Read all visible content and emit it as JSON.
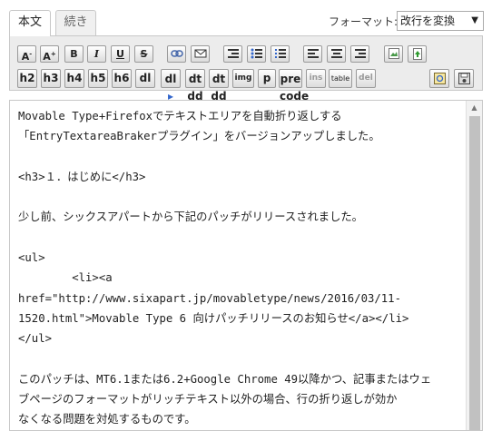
{
  "tabs": [
    {
      "label": "本文",
      "active": true
    },
    {
      "label": "続き",
      "active": false
    }
  ],
  "format": {
    "label": "フォーマット:",
    "selected": "改行を変換",
    "caret": "▼"
  },
  "toolbar": {
    "row1": [
      {
        "name": "font-smaller-button",
        "label": "A",
        "icon": "font-decrease-icon"
      },
      {
        "name": "font-larger-button",
        "label": "A",
        "icon": "font-increase-icon"
      },
      {
        "name": "bold-button",
        "label": "B"
      },
      {
        "name": "italic-button",
        "label": "I"
      },
      {
        "name": "underline-button",
        "label": "U"
      },
      {
        "name": "strikethrough-button",
        "label": "S"
      },
      {
        "name": "link-button",
        "icon": "link-icon"
      },
      {
        "name": "email-button",
        "icon": "envelope-icon"
      },
      {
        "name": "indent-button",
        "icon": "indent-icon"
      },
      {
        "name": "bullet-list-button",
        "icon": "bullet-list-icon"
      },
      {
        "name": "numbered-list-button",
        "icon": "numbered-list-icon"
      },
      {
        "name": "align-left-button",
        "icon": "align-left-icon"
      },
      {
        "name": "align-center-button",
        "icon": "align-center-icon"
      },
      {
        "name": "align-right-button",
        "icon": "align-right-icon"
      },
      {
        "name": "insert-image-button",
        "icon": "image-icon"
      },
      {
        "name": "insert-file-button",
        "icon": "upload-file-icon"
      }
    ],
    "row2": [
      {
        "name": "h2-button",
        "label": "h2"
      },
      {
        "name": "h3-button",
        "label": "h3"
      },
      {
        "name": "h4-button",
        "label": "h4"
      },
      {
        "name": "h5-button",
        "label": "h5"
      },
      {
        "name": "h6-button",
        "label": "h6"
      },
      {
        "name": "dl-button",
        "label": "dl"
      },
      {
        "name": "dl-dt-button",
        "label": "dl"
      },
      {
        "name": "dt-dd-button",
        "label": "dt dd"
      },
      {
        "name": "dt-dd-2-button",
        "label": "dt dd"
      },
      {
        "name": "img-button",
        "label": "img"
      },
      {
        "name": "p-button",
        "label": "p"
      },
      {
        "name": "pre-code-button",
        "label": "pre code"
      },
      {
        "name": "ins-button",
        "label": "ins"
      },
      {
        "name": "table-button",
        "label": "table"
      },
      {
        "name": "del-button",
        "label": "del"
      },
      {
        "name": "preview-button",
        "icon": "preview-icon"
      },
      {
        "name": "save-button",
        "icon": "save-icon"
      }
    ]
  },
  "editor": {
    "lines": [
      "Movable Type+Firefoxでテキストエリアを自動折り返しする",
      "「EntryTextareaBrakerプラグイン」をバージョンアップしました。",
      "",
      "<h3>１．はじめに</h3>",
      "",
      "少し前、シックスアパートから下記のパッチがリリースされました。",
      "",
      "<ul>",
      "\t<li><a",
      "href=\"http://www.sixapart.jp/movabletype/news/2016/03/11-",
      "1520.html\">Movable Type 6 向けパッチリリースのお知らせ</a></li>",
      "</ul>",
      "",
      "このパッチは、MT6.1または6.2+Google Chrome 49以降かつ、記事またはウェ",
      "ブページのフォーマットがリッチテキスト以外の場合、行の折り返しが効か",
      "なくなる問題を対処するものです。"
    ]
  }
}
